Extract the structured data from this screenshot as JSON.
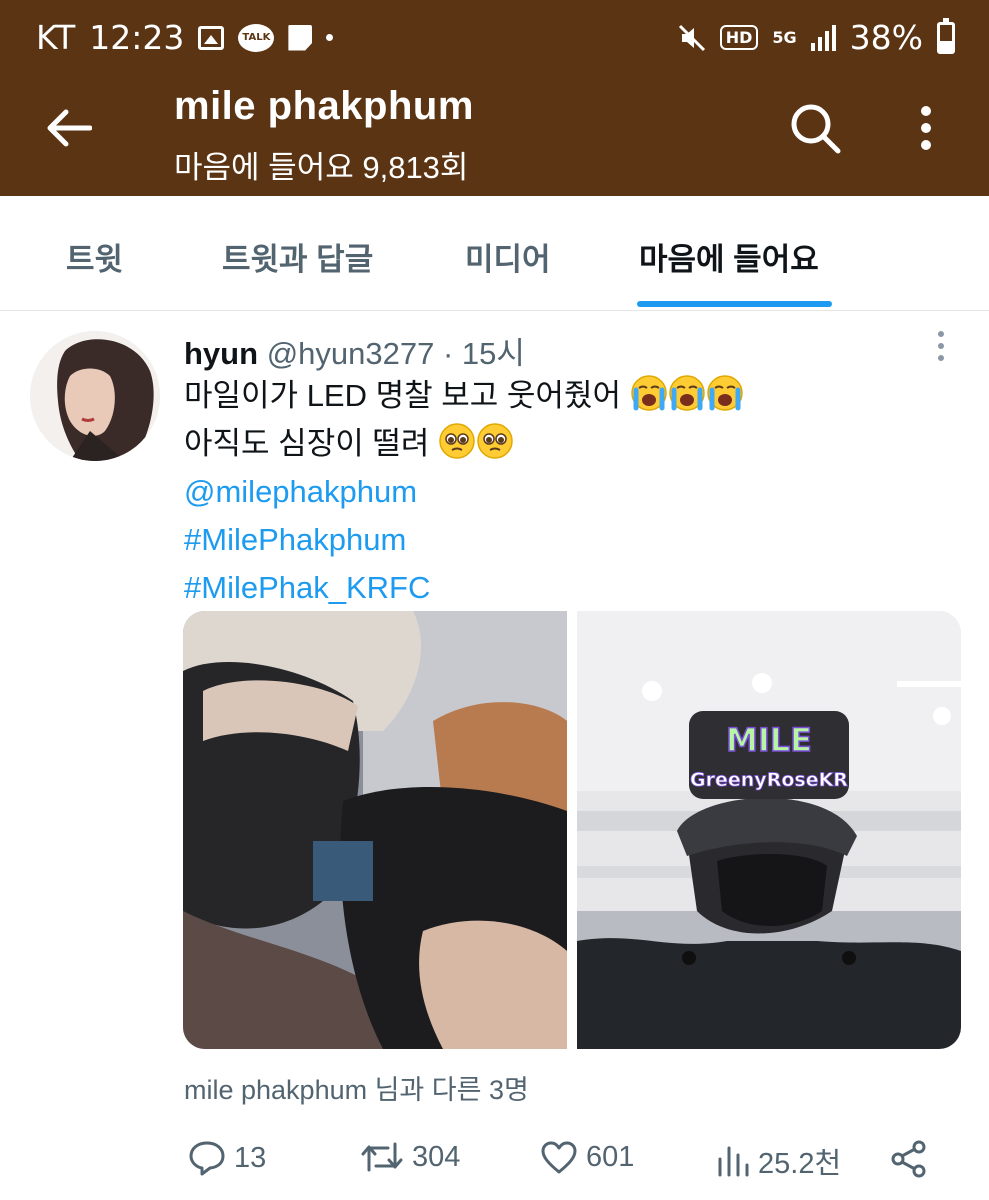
{
  "status_bar": {
    "carrier": "KT",
    "time": "12:23",
    "icons": [
      "gallery-icon",
      "kakaotalk-icon",
      "note-icon",
      "dot-icon",
      "mute-icon",
      "hd-icon",
      "5g-icon",
      "signal-icon",
      "battery-icon"
    ],
    "talk_label": "TALK",
    "hd_label": "HD",
    "network_label": "5G",
    "battery": "38%",
    "battery_level": 0.38
  },
  "header": {
    "title": "mile phakphum",
    "subtitle": "마음에 들어요 9,813회",
    "background_color": "#5b3413"
  },
  "tabs": [
    {
      "label": "트윗",
      "active": false
    },
    {
      "label": "트윗과 답글",
      "active": false
    },
    {
      "label": "미디어",
      "active": false
    },
    {
      "label": "마음에 들어요",
      "active": true
    }
  ],
  "accent_color": "#1d9bf0",
  "tweet": {
    "author_name": "hyun",
    "author_handle": "@hyun3277",
    "separator": " · ",
    "time": "15시",
    "text_line1": "마일이가 LED 명찰 보고 웃어줬어",
    "text_line1_emoji": [
      "loudly-crying-face",
      "loudly-crying-face",
      "loudly-crying-face"
    ],
    "text_line2": "아직도 심장이 떨려",
    "text_line2_emoji": [
      "pleading-face",
      "pleading-face"
    ],
    "mention": "@milephakphum",
    "hashtags": [
      "#MilePhakphum",
      "#MilePhak_KRFC"
    ],
    "media": [
      {
        "description": "photo"
      },
      {
        "description": "photo",
        "led_sign_top": "MILE",
        "led_sign_bottom": "GreenyRoseKR"
      }
    ],
    "tagged": "mile phakphum 님과 다른 3명",
    "actions": {
      "replies": "13",
      "retweets": "304",
      "likes": "601",
      "views": "25.2천"
    }
  }
}
